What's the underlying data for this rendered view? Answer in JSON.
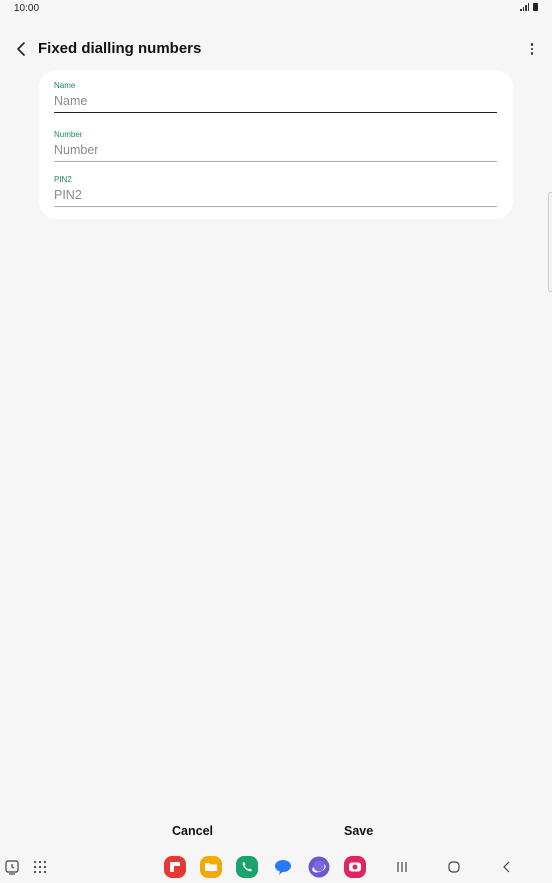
{
  "status_bar": {
    "time": "10:00"
  },
  "app_bar": {
    "title": "Fixed dialling numbers"
  },
  "form": {
    "fields": [
      {
        "label": "Name",
        "placeholder": "Name",
        "value": ""
      },
      {
        "label": "Number",
        "placeholder": "Number",
        "value": ""
      },
      {
        "label": "PIN2",
        "placeholder": "PIN2",
        "value": ""
      }
    ]
  },
  "actions": {
    "cancel_label": "Cancel",
    "save_label": "Save"
  },
  "colors": {
    "accent": "#1a8a5a",
    "background": "#f6f6f6",
    "card": "#ffffff"
  },
  "dock": {
    "apps": [
      {
        "icon": "flipboard-red-icon",
        "color": "#e53935"
      },
      {
        "icon": "folder-yellow-icon",
        "color": "#f2a900"
      },
      {
        "icon": "phone-green-icon",
        "color": "#1aa36a"
      },
      {
        "icon": "messages-blue-icon",
        "color": "#2979ff"
      },
      {
        "icon": "internet-purple-icon",
        "color": "#6a5acd"
      },
      {
        "icon": "camera-pink-icon",
        "color": "#e0245e"
      }
    ]
  }
}
